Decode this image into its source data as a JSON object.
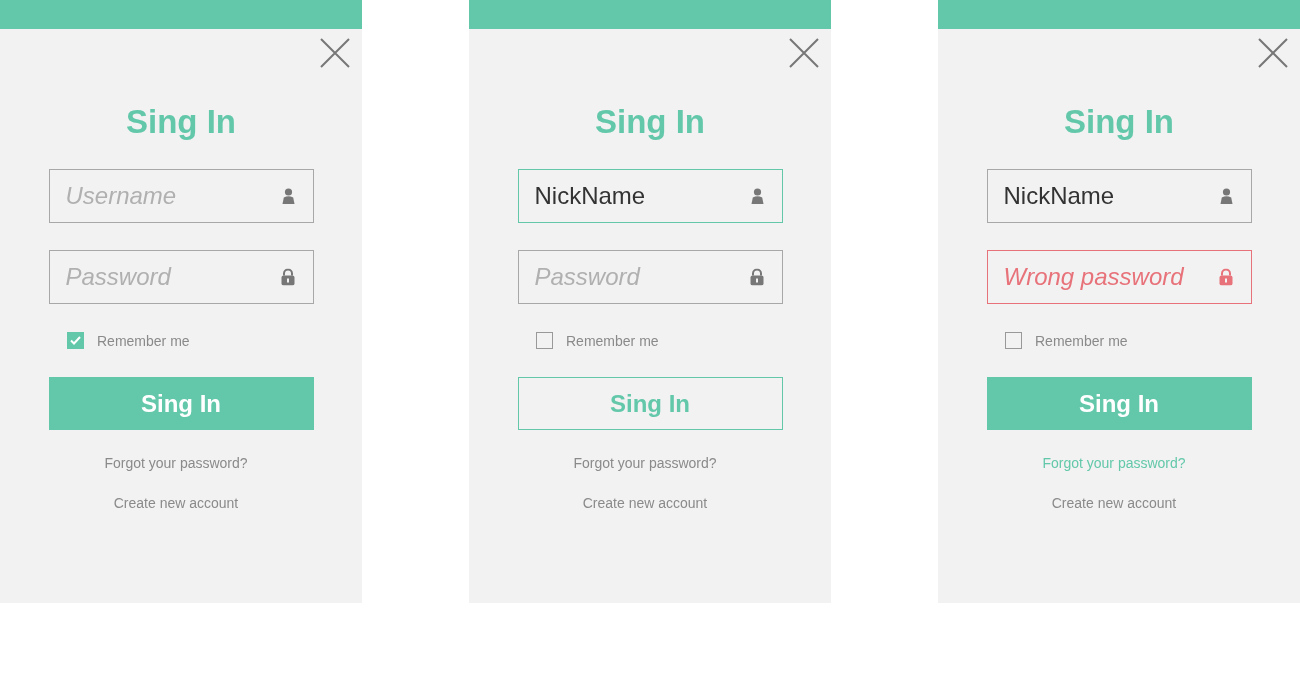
{
  "panels": [
    {
      "title": "Sing In",
      "fields": [
        {
          "kind": "user",
          "placeholder": "Username",
          "focused": false,
          "error": false
        },
        {
          "kind": "lock",
          "placeholder": "Password",
          "focused": false,
          "error": false
        }
      ],
      "remember": {
        "label": "Remember me",
        "checked": true
      },
      "button": {
        "label": "Sing In",
        "outlined": false
      },
      "forgot": {
        "label": "Forgot your password?",
        "highlighted": false
      },
      "create": {
        "label": "Create new account"
      }
    },
    {
      "title": "Sing In",
      "fields": [
        {
          "kind": "user",
          "value": "NickName",
          "focused": true,
          "error": false
        },
        {
          "kind": "lock",
          "placeholder": "Password",
          "focused": false,
          "error": false
        }
      ],
      "remember": {
        "label": "Remember me",
        "checked": false
      },
      "button": {
        "label": "Sing In",
        "outlined": true
      },
      "forgot": {
        "label": "Forgot your password?",
        "highlighted": false
      },
      "create": {
        "label": "Create new account"
      }
    },
    {
      "title": "Sing In",
      "fields": [
        {
          "kind": "user",
          "value": "NickName",
          "focused": false,
          "error": false
        },
        {
          "kind": "lock",
          "placeholder": "Wrong password",
          "focused": false,
          "error": true
        }
      ],
      "remember": {
        "label": "Remember me",
        "checked": false
      },
      "button": {
        "label": "Sing In",
        "outlined": false
      },
      "forgot": {
        "label": "Forgot your password?",
        "highlighted": true
      },
      "create": {
        "label": "Create new account"
      }
    }
  ]
}
